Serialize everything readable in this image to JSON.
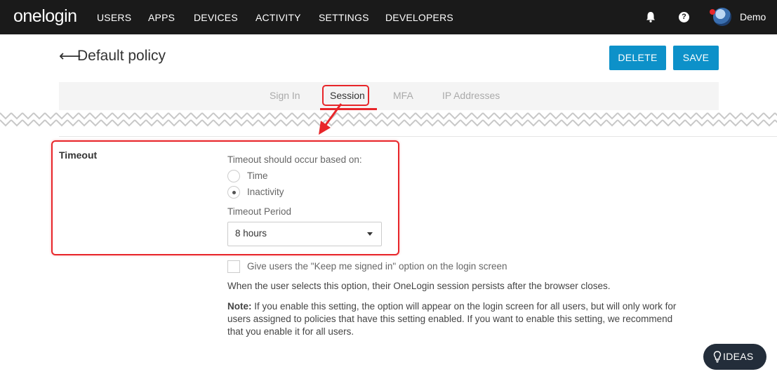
{
  "header": {
    "logo": "onelogin",
    "nav": [
      "USERS",
      "APPS",
      "DEVICES",
      "ACTIVITY",
      "SETTINGS",
      "DEVELOPERS"
    ],
    "user_name": "Demo",
    "help_glyph": "?",
    "icons": {
      "bell": "bell-icon",
      "help": "help-icon",
      "avatar": "user-avatar"
    }
  },
  "page": {
    "back_glyph": "⟵",
    "title": "Default policy",
    "delete_label": "DELETE",
    "save_label": "SAVE"
  },
  "tabs": [
    "Sign In",
    "Session",
    "MFA",
    "IP Addresses"
  ],
  "active_tab": "Session",
  "timeout": {
    "section_label": "Timeout",
    "question": "Timeout should occur based on:",
    "options": [
      "Time",
      "Inactivity"
    ],
    "selected": "Inactivity",
    "period_label": "Timeout Period",
    "period_value": "8 hours"
  },
  "keep_signed_in": {
    "checkbox_label": "Give users the \"Keep me signed in\" option on the login screen",
    "checked": false,
    "description": "When the user selects this option, their OneLogin session persists after the browser closes.",
    "note_label": "Note:",
    "note_lines": [
      " If you enable this setting, the option will appear on the login screen for all users, but will only work for",
      "users assigned to policies that have this setting enabled. If you want to enable this setting, we recommend",
      "that you enable it for all users."
    ]
  },
  "ideas_button": {
    "label": "IDEAS",
    "icon": "lightbulb-icon"
  },
  "colors": {
    "topbar": "#1a1a1a",
    "accent_blue": "#0d91c9",
    "highlight_red": "#e8262a",
    "ideas_bg": "#232d3a"
  }
}
